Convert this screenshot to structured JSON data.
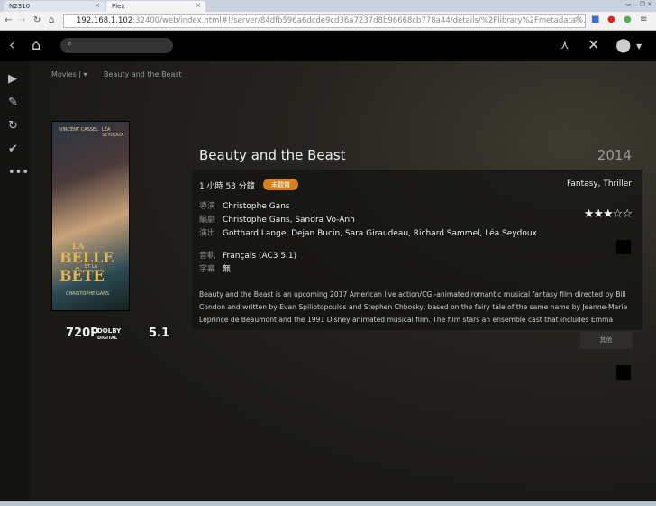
{
  "browser": {
    "tabs": [
      {
        "label": "N2310"
      },
      {
        "label": "Plex"
      }
    ],
    "url_host": "192.168.1.102",
    "url_rest": ":32400/web/index.html#!/server/84dfb596a6dcde9cd36a7237d8b96668cb778a44/details/%2Flibrary%2Fmetadata%..."
  },
  "breadcrumb": {
    "section": "Movies",
    "current": "Beauty and the Beast"
  },
  "poster": {
    "top_left": "VINCENT CASSEL",
    "top_right": "LÉA SEYDOUX",
    "title_line1": "LA",
    "title_line2": "BELLE",
    "title_line3": "ET LA",
    "title_line4": "BÊTE",
    "director": "CHRISTOPHE GANS"
  },
  "media_badges": {
    "resolution": "720P",
    "audio_brand": "DOLBY",
    "audio_sub": "DIGITAL",
    "channels": "5.1"
  },
  "movie": {
    "title": "Beauty and the Beast",
    "year": "2014",
    "duration": "1 小時 53 分鐘",
    "status_badge": "未觀賞",
    "genres": "Fantasy, Thriller",
    "rating": 3,
    "rating_stars": "★★★☆☆",
    "director_label": "導演",
    "director": "Christophe Gans",
    "writer_label": "編劇",
    "writers": "Christophe Gans, Sandra Vo-Anh",
    "cast_label": "演出",
    "cast": "Gotthard Lange, Dejan Bucin, Sara Giraudeau, Richard Sammel, Léa Seydoux",
    "audio_label": "音軌",
    "audio": "Français (AC3 5.1)",
    "subtitle_label": "字幕",
    "subtitle": "無",
    "summary": "Beauty and the Beast is an upcoming 2017 American live action/CGI-animated romantic musical fantasy film directed by Bill Condon and written by Evan Spiliotopoulos and Stephen Chbosky, based on the fairy tale of the same name by Jeanne-Marie Leprince de Beaumont and the 1991 Disney animated musical film. The film stars an ensemble cast that includes Emma",
    "more_label": "其他"
  },
  "colors": {
    "accent": "#d5811e"
  }
}
